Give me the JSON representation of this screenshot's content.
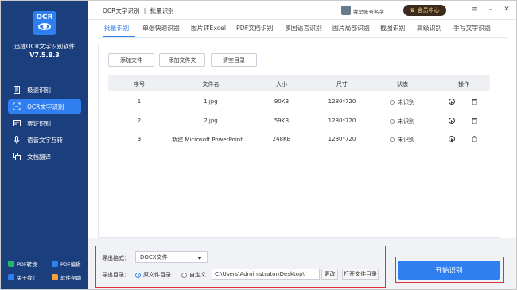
{
  "sidebar": {
    "logo_text": "OCR",
    "app_name": "迅捷OCR文字识别软件",
    "version": "V7.5.8.3",
    "nav": [
      {
        "label": "极速识别",
        "icon": "document-icon"
      },
      {
        "label": "OCR文字识别",
        "icon": "ocr-icon"
      },
      {
        "label": "票证识别",
        "icon": "ticket-icon"
      },
      {
        "label": "语音文字互转",
        "icon": "microphone-icon"
      },
      {
        "label": "文档翻译",
        "icon": "translate-icon"
      }
    ],
    "footer": [
      {
        "label": "PDF转换",
        "color": "#1fb86b"
      },
      {
        "label": "PDF编辑",
        "color": "#2f7ff0"
      },
      {
        "label": "关于我们",
        "color": "#2f7ff0"
      },
      {
        "label": "软件帮助",
        "color": "#f29f3c"
      }
    ]
  },
  "topbar": {
    "breadcrumb_root": "OCR文字识别",
    "breadcrumb_sep": "|",
    "breadcrumb_current": "批量识别",
    "username": "我是账号名字",
    "vip_label": "会员中心"
  },
  "tabs": [
    "批量识别",
    "单张快速识别",
    "图片转Excel",
    "PDF文档识别",
    "多国语言识别",
    "图片局部识别",
    "截图识别",
    "高级识别",
    "手写文字识别"
  ],
  "toolbar": {
    "add_file": "添加文件",
    "add_folder": "添加文件夹",
    "clear": "清空目录"
  },
  "table": {
    "headers": [
      "序号",
      "文件名",
      "大小",
      "尺寸",
      "状态",
      "操作"
    ],
    "rows": [
      {
        "index": "1",
        "name": "1.jpg",
        "size": "90KB",
        "dims": "1280*720",
        "status": "未识别"
      },
      {
        "index": "2",
        "name": "2.jpg",
        "size": "59KB",
        "dims": "1280*720",
        "status": "未识别"
      },
      {
        "index": "3",
        "name": "新建 Microsoft PowerPoint ...",
        "size": "248KB",
        "dims": "1280*720",
        "status": "未识别"
      }
    ]
  },
  "export": {
    "format_label": "导出格式：",
    "format_value": "DOCX文件",
    "dir_label": "导出目录：",
    "radio_source": "原文件目录",
    "radio_custom": "自定义",
    "path": "C:\\Users\\Administrator\\Desktop\\",
    "change_btn": "更改",
    "open_btn": "打开文件目录"
  },
  "start_btn": "开始识别",
  "colors": {
    "sidebar_bg": "#1b3e7c",
    "accent": "#2f7ff0",
    "highlight": "#e0303b"
  }
}
